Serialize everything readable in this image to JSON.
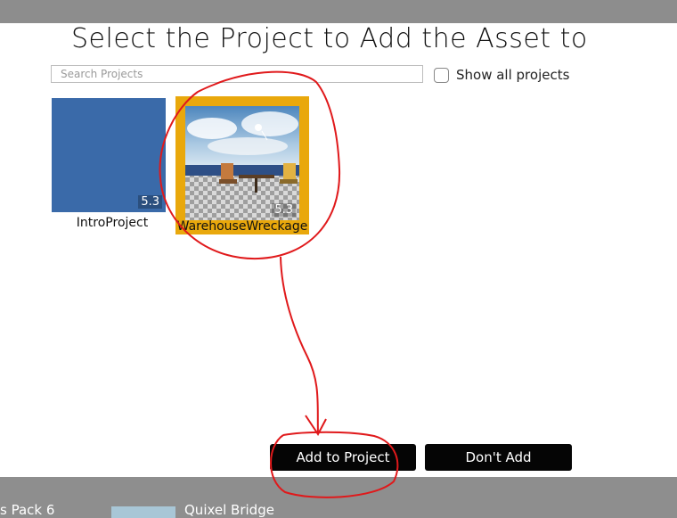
{
  "dialog": {
    "title": "Select the Project to Add the Asset to",
    "search": {
      "placeholder": "Search Projects",
      "value": ""
    },
    "show_all_label": "Show all projects",
    "show_all_checked": false
  },
  "projects": [
    {
      "name": "IntroProject",
      "version": "5.3",
      "selected": false
    },
    {
      "name": "WarehouseWreckage",
      "version": "5.3",
      "selected": true
    }
  ],
  "buttons": {
    "add": "Add to Project",
    "dont_add": "Don't Add"
  },
  "bottom_bar": {
    "left_text": "s Pack 6",
    "right_text": "Quixel Bridge"
  },
  "colors": {
    "selection": "#e9a80c",
    "intro_thumb": "#3a6aa9",
    "annotation": "#e0191b"
  }
}
